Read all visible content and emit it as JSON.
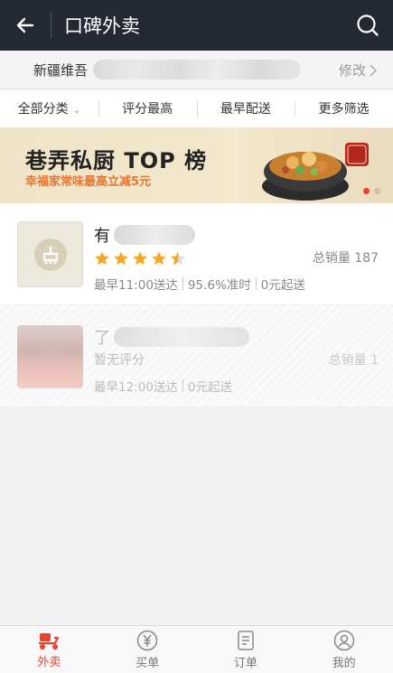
{
  "header": {
    "title": "口碑外卖",
    "back_icon": "back-arrow-icon",
    "search_icon": "search-icon"
  },
  "address": {
    "prefix": "新疆维吾",
    "change_label": "修改"
  },
  "filters": [
    {
      "label": "全部分类",
      "has_caret": true
    },
    {
      "label": "评分最高"
    },
    {
      "label": "最早配送"
    },
    {
      "label": "更多筛选"
    }
  ],
  "banner": {
    "title": "巷弄私厨 TOP 榜",
    "subtitle": "幸福家常味最高立减5元",
    "accent": "#e8762e"
  },
  "shops": [
    {
      "name_prefix": "有",
      "rating": 4.5,
      "sales": "总销量 187",
      "delivery": "最早11:00送达",
      "on_time": "95.6%准时",
      "min_order": "0元起送"
    },
    {
      "name_prefix": "了",
      "rating_text": "暂无评分",
      "sales": "总销量 1",
      "delivery": "最早12:00送达",
      "min_order": "0元起送"
    }
  ],
  "tabs": [
    {
      "label": "外卖",
      "icon": "delivery-scooter-icon",
      "active": true
    },
    {
      "label": "买单",
      "icon": "yen-icon"
    },
    {
      "label": "订单",
      "icon": "order-icon"
    },
    {
      "label": "我的",
      "icon": "profile-icon"
    }
  ],
  "colors": {
    "header_bg": "#232833",
    "active": "#e8432d",
    "star": "#f5a623"
  }
}
